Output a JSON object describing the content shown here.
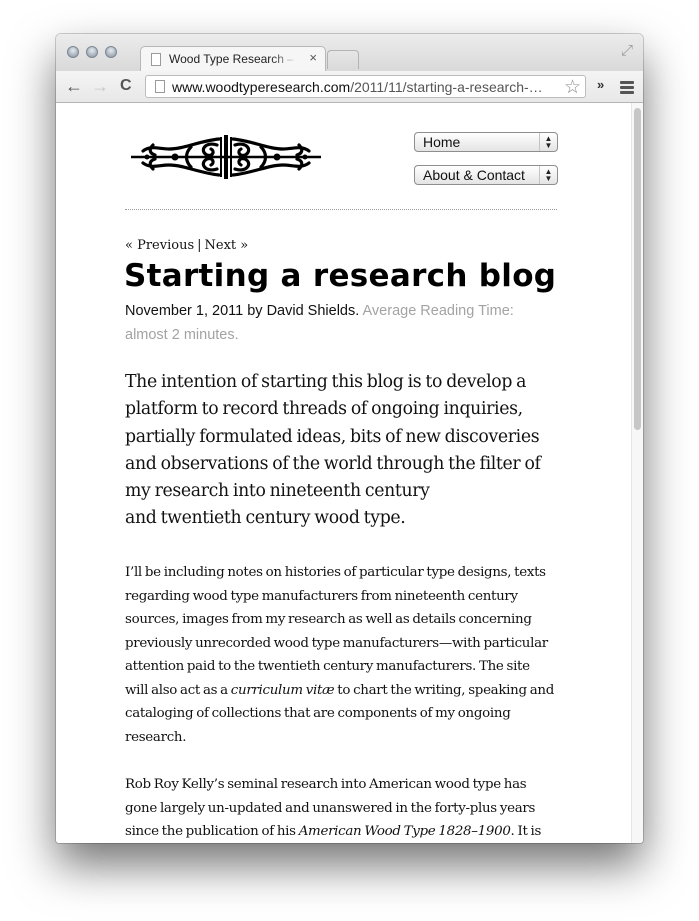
{
  "browser": {
    "tab": {
      "title": "Wood Type Research – Starting a research blog",
      "close": "×"
    },
    "url": {
      "host": "www.woodtyperesearch.com",
      "path": "/2011/11/starting-a-research-…"
    },
    "icons": {
      "back": "←",
      "forward": "→",
      "reload": "C",
      "star": "☆",
      "overflow": "»",
      "fullscreen": "⤢"
    }
  },
  "site": {
    "nav": [
      {
        "label": "Home"
      },
      {
        "label": "About & Contact"
      }
    ],
    "select_arrows": "▲\n▼"
  },
  "post": {
    "pager": {
      "previous": "« Previous",
      "separator": "|",
      "next": "Next »"
    },
    "title": "Starting a research blog",
    "meta": {
      "byline": "November 1, 2011 by David Shields.",
      "reading_time": "Average Reading Time: almost 2 minutes."
    },
    "lead_lines": [
      "The intention of starting this blog is to develop a",
      "platform to record threads of ongoing inquiries,",
      "partially formulated ideas, bits of new discoveries",
      "and observations of the world through the filter of",
      "my research into nineteenth century",
      "and twentieth century wood type."
    ],
    "paragraph1": {
      "lines": [
        "I’ll be including notes on histories of particular type designs, texts",
        "regarding wood type manufacturers from nineteenth century",
        "sources, images from my research as well as details concerning",
        "previously unrecorded wood type manufacturers—with particular",
        "attention paid to the twentieth century manufacturers. The site"
      ],
      "line6_before": "will also act as a ",
      "line6_em": "curriculum vitæ",
      "line6_after": " to chart the writing, speaking and",
      "line7": "cataloging of collections that are components of my ongoing",
      "line8": "research."
    },
    "paragraph2": {
      "line1": "Rob Roy Kelly’s seminal research into American wood type has",
      "line2": "gone largely un-updated and unanswered in the forty-plus years",
      "line3_before": "since the publication of his ",
      "line3_em": "American Wood Type 1828–1900",
      "line3_after": ". It is"
    }
  }
}
